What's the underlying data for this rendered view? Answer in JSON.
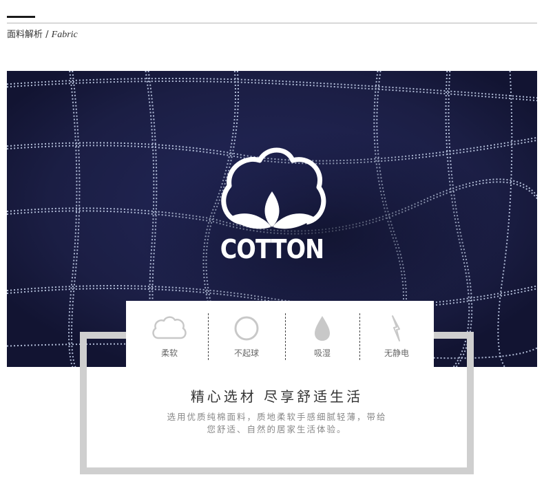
{
  "header": {
    "title_cn": "面料解析",
    "separator": " / ",
    "title_en": "Fabric"
  },
  "hero": {
    "logo_text": "COTTON",
    "fabric_color": "#1c1f45",
    "grid_color": "#c4d0ea"
  },
  "features": [
    {
      "label": "柔软",
      "icon": "cloud-icon"
    },
    {
      "label": "不起球",
      "icon": "circle-icon"
    },
    {
      "label": "吸湿",
      "icon": "water-drop-icon"
    },
    {
      "label": "无静电",
      "icon": "lightning-icon"
    }
  ],
  "info": {
    "title": "精心选材 尽享舒适生活",
    "desc_line1": "选用优质纯棉面料，质地柔软手感细腻轻薄，带给",
    "desc_line2": "您舒适、自然的居家生活体验。"
  }
}
